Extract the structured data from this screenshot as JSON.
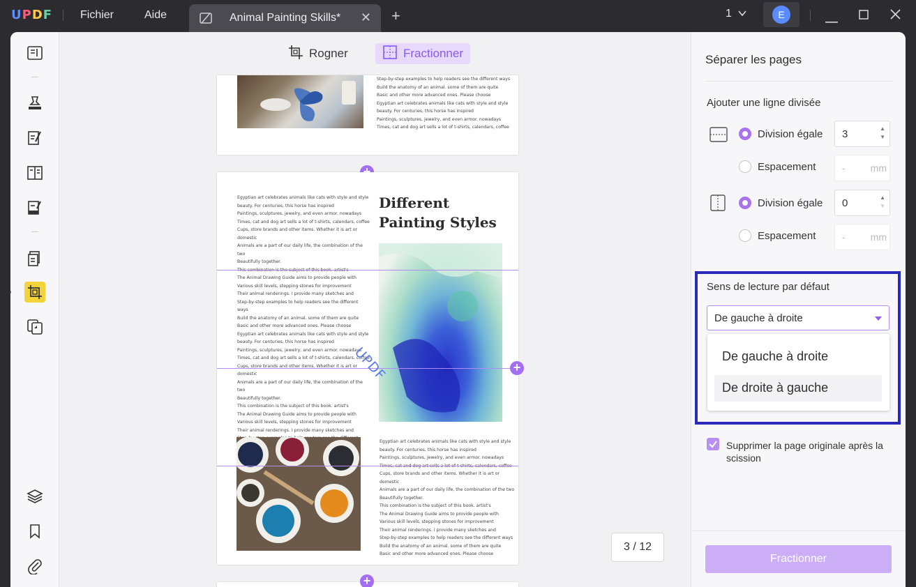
{
  "titlebar": {
    "logo": "UPDF",
    "menu": [
      "Fichier",
      "Aide"
    ],
    "tab_title": "Animal Painting Skills*",
    "page_number": "1",
    "avatar_letter": "E"
  },
  "toolbar": {
    "crop_label": "Rogner",
    "split_label": "Fractionner"
  },
  "document": {
    "top_page_text": "Step-by-step examples to help readers see the different ways\nBuild the anatomy of an animal. some of them are quite\nBasic and other more advanced ones. Please choose\nEgyptian art celebrates animals like cats with style and style\nbeauty. For centuries, this horse has inspired\nPaintings, sculptures, jewelry, and even armor. nowadays\nTimes, cat and dog art sells a lot of t-shirts, calendars, coffee",
    "left_column_text": "Egyptian art celebrates animals like cats with style and style\nbeauty. For centuries, this horse has inspired\nPaintings, sculptures, jewelry, and even armor. nowadays\nTimes, cat and dog art sells a lot of t-shirts, calendars, coffee\nCups, store brands and other items. Whether it is art or domestic\nAnimals are a part of our daily life, the combination of the two\nBeautifully together.\nThis combination is the subject of this book. artist's\nThe Animal Drawing Guide aims to provide people with\nVarious skill levels, stepping stones for improvement\nTheir animal renderings. I provide many sketches and\nStep-by-step examples to help readers see the different ways\nBuild the anatomy of an animal. some of them are quite\nBasic and other more advanced ones. Please choose\nEgyptian art celebrates animals like cats with style and style\nbeauty. For centuries, this horse has inspired\nPaintings, sculptures, jewelry, and even armor. nowadays\nTimes, cat and dog art sells a lot of t-shirts, calendars, coffee\nCups, store brands and other items. Whether it is art or domestic\nAnimals are a part of our daily life, the combination of the two\nBeautifully together.\nThis combination is the subject of this book. artist's\nThe Animal Drawing Guide aims to provide people with\nVarious skill levels, stepping stones for improvement\nTheir animal renderings. I provide many sketches and\nStep-by-step examples to help readers see the different ways\nBuild the anatomy of an animal. some of them are quite\nBasic and other more advanced ones. Please choose",
    "bottom_right_text": "Egyptian art celebrates animals like cats with style and style\nbeauty. For centuries, this horse has inspired\nPaintings, sculptures, jewelry, and even armor. nowadays\nTimes, cat and dog art sells a lot of t-shirts, calendars, coffee\nCups, store brands and other items. Whether it is art or domestic\nAnimals are a part of our daily life, the combination of the two\nBeautifully together.\nThis combination is the subject of this book. artist's\nThe Animal Drawing Guide aims to provide people with\nVarious skill levels, stepping stones for improvement\nTheir animal renderings. I provide many sketches and\nStep-by-step examples to help readers see the different ways\nBuild the anatomy of an animal. some of them are quite\nBasic and other more advanced ones. Please choose",
    "heading": "Different Painting Styles",
    "watermark": "UPDF",
    "page_counter": "3 / 12"
  },
  "panel": {
    "title": "Séparer les pages",
    "add_line_label": "Ajouter une ligne divisée",
    "horizontal": {
      "equal_label": "Division égale",
      "equal_value": "3",
      "spacing_label": "Espacement",
      "spacing_placeholder": "-",
      "unit": "mm"
    },
    "vertical": {
      "equal_label": "Division égale",
      "equal_value": "0",
      "spacing_label": "Espacement",
      "spacing_placeholder": "-",
      "unit": "mm"
    },
    "reading_label": "Sens de lecture par défaut",
    "reading_selected": "De gauche à droite",
    "reading_options": [
      "De gauche à droite",
      "De droite à gauche"
    ],
    "delete_original_label": "Supprimer la page originale après la scission",
    "split_button": "Fractionner"
  },
  "colors": {
    "accent": "#8b5cf6",
    "highlight_box": "#2a2ab8",
    "active_tool": "#f2d33a"
  }
}
